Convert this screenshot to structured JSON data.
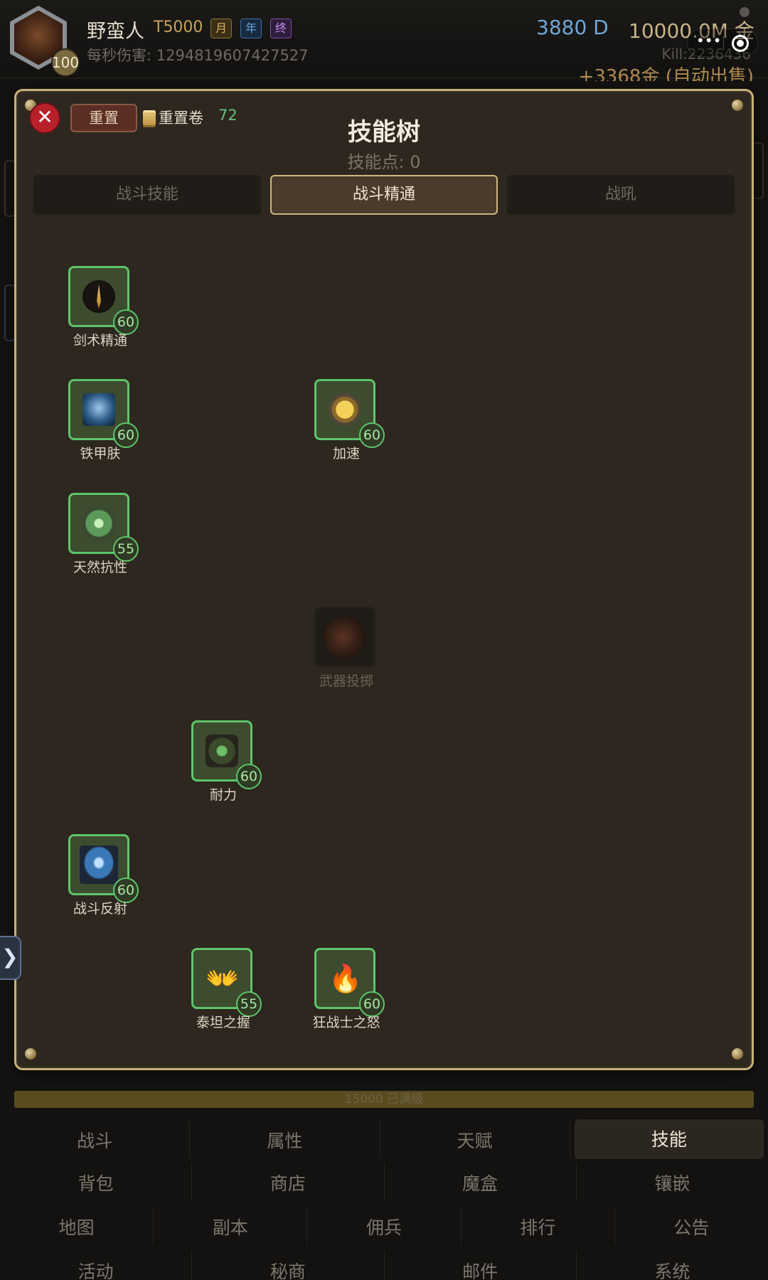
{
  "header": {
    "player_name": "野蛮人",
    "tier": "T5000",
    "level": "100",
    "passes": [
      "月",
      "年",
      "终"
    ],
    "dps_label": "每秒伤害: 1294819607427527",
    "diamonds": "3880 D",
    "gold": "10000.0M 金",
    "kills": "Kill:2236436",
    "income": "+3368金 (自动出售)"
  },
  "capsule": {
    "more": "•••"
  },
  "dialog": {
    "close_symbol": "✕",
    "reset_label": "重置",
    "reset_scroll_label": "重置卷",
    "reset_scroll_count": "72",
    "title": "技能树",
    "skill_points": "技能点: 0",
    "tabs": [
      {
        "label": "战斗技能",
        "active": false
      },
      {
        "label": "战斗精通",
        "active": true
      },
      {
        "label": "战吼",
        "active": false
      }
    ],
    "skills": [
      {
        "name": "剑术精通",
        "level": "60",
        "icon": "sword-icon",
        "locked": false
      },
      {
        "name": "铁甲肤",
        "level": "60",
        "icon": "armor-icon",
        "locked": false
      },
      {
        "name": "加速",
        "level": "60",
        "icon": "lightning-icon",
        "locked": false
      },
      {
        "name": "天然抗性",
        "level": "55",
        "icon": "nature-icon",
        "locked": false
      },
      {
        "name": "武器投掷",
        "level": "",
        "icon": "throw-icon",
        "locked": true
      },
      {
        "name": "耐力",
        "level": "60",
        "icon": "endurance-icon",
        "locked": false
      },
      {
        "name": "战斗反射",
        "level": "60",
        "icon": "reflect-icon",
        "locked": false
      },
      {
        "name": "泰坦之握",
        "level": "55",
        "icon": "hands-icon",
        "glyph": "👐",
        "locked": false
      },
      {
        "name": "狂战士之怒",
        "level": "60",
        "icon": "fire-icon",
        "glyph": "🔥",
        "locked": false
      }
    ]
  },
  "progress": {
    "label": "15000 已满级",
    "fill": 1.0
  },
  "side_arrow": "❯",
  "nav": {
    "row1": [
      "战斗",
      "属性",
      "天赋",
      "技能"
    ],
    "row2": [
      "背包",
      "商店",
      "魔盒",
      "镶嵌"
    ],
    "row3": [
      "地图",
      "副本",
      "佣兵",
      "排行",
      "公告"
    ],
    "row4": [
      "活动",
      "秘商",
      "邮件",
      "系统"
    ],
    "active": "技能"
  },
  "colors": {
    "accent_gold": "#c9b07a",
    "skill_border": "#5ec46a",
    "close_red": "#b8212a"
  }
}
